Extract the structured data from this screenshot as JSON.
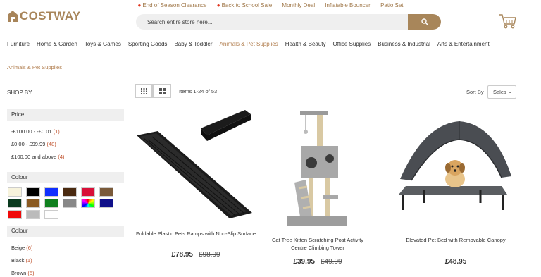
{
  "promo_bar": [
    {
      "label": "End of Season Clearance",
      "hot": true
    },
    {
      "label": "Back to School Sale",
      "hot": true
    },
    {
      "label": "Monthly Deal",
      "hot": false
    },
    {
      "label": "Inflatable Bouncer",
      "hot": false
    },
    {
      "label": "Patio Set",
      "hot": false
    }
  ],
  "header": {
    "logo_text": "COSTWAY",
    "search_placeholder": "Search entire store here...",
    "brand_color": "#a8865a"
  },
  "nav": [
    "Furniture",
    "Home & Garden",
    "Toys & Games",
    "Sporting Goods",
    "Baby & Toddler",
    "Animals & Pet Supplies",
    "Health & Beauty",
    "Office Supplies",
    "Business & Industrial",
    "Arts & Entertainment"
  ],
  "nav_active_index": 5,
  "breadcrumb": "Animals & Pet Supplies",
  "sidebar": {
    "shop_by": "SHOP BY",
    "price": {
      "title": "Price",
      "options": [
        {
          "label": "-£100.00 - -£0.01",
          "count": "(1)"
        },
        {
          "label": "£0.00 - £99.99",
          "count": "(48)"
        },
        {
          "label": "£100.00 and above",
          "count": "(4)"
        }
      ]
    },
    "colour_swatch": {
      "title": "Colour",
      "colors": [
        "#f7f3dc",
        "#000000",
        "#1030ff",
        "#4a2a10",
        "#d81038",
        "#7a5a3a",
        "#0a3a1e",
        "#8a5a22",
        "#10801e",
        "#888888",
        "multi",
        "#10108a",
        "#f00a0a",
        "#bbbbbb",
        "#ffffff"
      ]
    },
    "colour_list": {
      "title": "Colour",
      "options": [
        {
          "label": "Beige",
          "count": "(6)"
        },
        {
          "label": "Black",
          "count": "(1)"
        },
        {
          "label": "Brown",
          "count": "(5)"
        }
      ]
    }
  },
  "toolbar": {
    "items_text": "Items 1-24 of 53",
    "sort_label": "Sort By",
    "sort_value": "Sales"
  },
  "products": [
    {
      "name": "Foldable Plastic Pets Ramps with Non-Slip Surface",
      "price": "£78.95",
      "old_price": "£98.99"
    },
    {
      "name": "Cat Tree Kitten Scratching Post Activity Centre Climbing Tower",
      "price": "£39.95",
      "old_price": "£49.99"
    },
    {
      "name": "Elevated Pet Bed with Removable Canopy",
      "price": "£48.95",
      "old_price": ""
    }
  ]
}
